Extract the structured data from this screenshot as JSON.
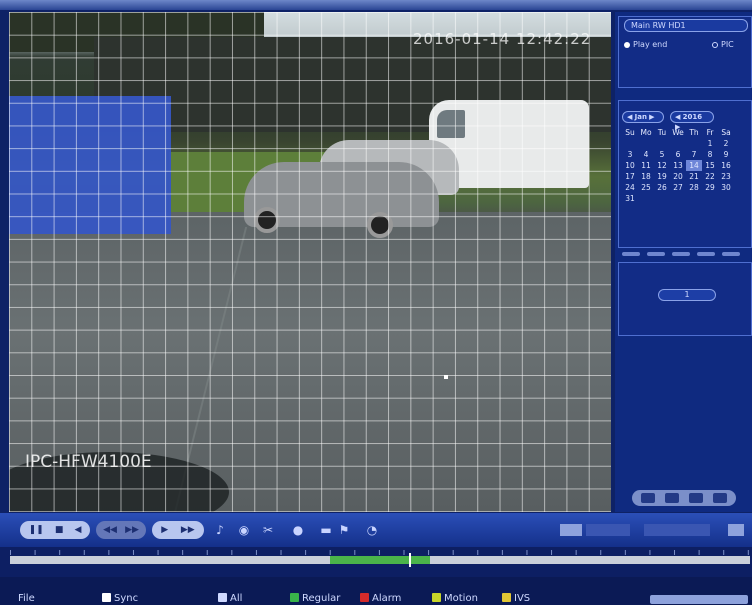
{
  "video": {
    "timestamp": "2016-01-14 12:42:22",
    "camera_name": "IPC-HFW4100E"
  },
  "right_panel": {
    "camera_select": "Main RW HD1",
    "mode_options": [
      "Play end",
      "PIC"
    ],
    "mode_selected": "Play end",
    "month": "Jan",
    "year": "2016",
    "weekdays": [
      "Su",
      "Mo",
      "Tu",
      "We",
      "Th",
      "Fr",
      "Sa"
    ],
    "calendar_rows": [
      [
        "",
        "",
        "",
        "",
        "",
        "1",
        "2"
      ],
      [
        "3",
        "4",
        "5",
        "6",
        "7",
        "8",
        "9"
      ],
      [
        "10",
        "11",
        "12",
        "13",
        "14",
        "15",
        "16"
      ],
      [
        "17",
        "18",
        "19",
        "20",
        "21",
        "22",
        "23"
      ],
      [
        "24",
        "25",
        "26",
        "27",
        "28",
        "29",
        "30"
      ],
      [
        "31",
        "",
        "",
        "",
        "",
        "",
        ""
      ]
    ],
    "highlighted_day": "14",
    "channel_value": "1"
  },
  "control_bar": {
    "icons": [
      "play-pause-icon",
      "stop-icon",
      "reverse-play-icon",
      "slow-icon",
      "fast-icon",
      "next-frame-icon",
      "prev-frame-icon",
      "volume-icon",
      "snapshot-icon",
      "clip-icon",
      "mark-icon",
      "tag-icon",
      "search-icon"
    ]
  },
  "bottom": {
    "file_label": "File",
    "sync_label": "Sync",
    "all_label": "All",
    "regular_label": "Regular",
    "alarm_label": "Alarm",
    "motion_label": "Motion",
    "ivs_label": "IVS",
    "colors": {
      "regular": "#39b34a",
      "alarm": "#d42b2b",
      "motion": "#c8d629",
      "ivs": "#e0c634"
    }
  }
}
